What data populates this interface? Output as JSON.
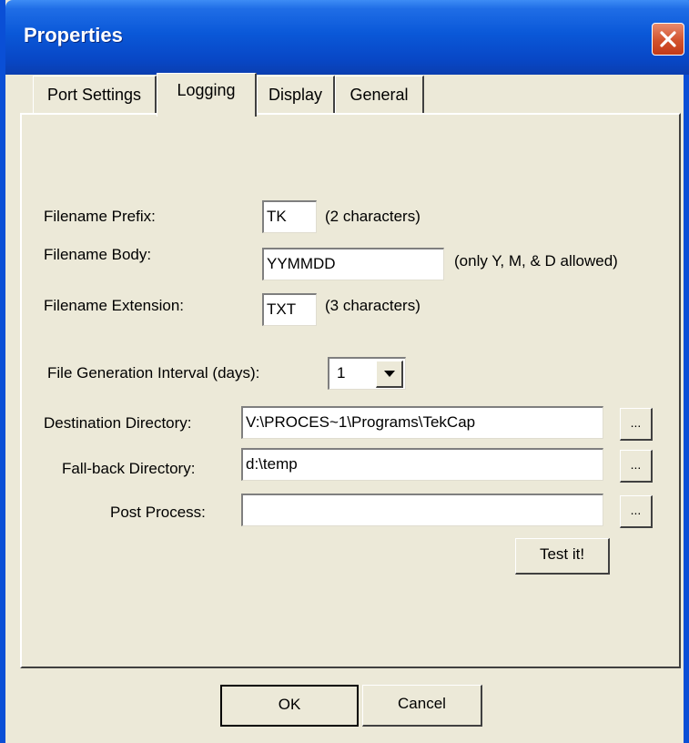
{
  "window": {
    "title": "Properties"
  },
  "tabs": [
    {
      "label": "Port Settings",
      "active": false
    },
    {
      "label": "Logging",
      "active": true
    },
    {
      "label": "Display",
      "active": false
    },
    {
      "label": "General",
      "active": false
    }
  ],
  "logging": {
    "prefix": {
      "label": "Filename Prefix:",
      "value": "TK",
      "hint": "(2 characters)"
    },
    "body": {
      "label": "Filename Body:",
      "value": "YYMMDD",
      "hint": "(only Y, M, & D allowed)"
    },
    "extension": {
      "label": "Filename Extension:",
      "value": "TXT",
      "hint": "(3 characters)"
    },
    "interval": {
      "label": "File Generation Interval (days):",
      "value": "1"
    },
    "destination": {
      "label": "Destination Directory:",
      "value": "V:\\PROCES~1\\Programs\\TekCap"
    },
    "fallback": {
      "label": "Fall-back Directory:",
      "value": "d:\\temp"
    },
    "post_process": {
      "label": "Post Process:",
      "value": ""
    },
    "browse_label": "...",
    "test_label": "Test it!"
  },
  "buttons": {
    "ok": "OK",
    "cancel": "Cancel"
  },
  "colors": {
    "title_bar": "#0a58d8",
    "close_button": "#d2522d",
    "face": "#ece9d8"
  },
  "icons": {
    "close": "close-icon",
    "dropdown": "chevron-down-icon"
  }
}
